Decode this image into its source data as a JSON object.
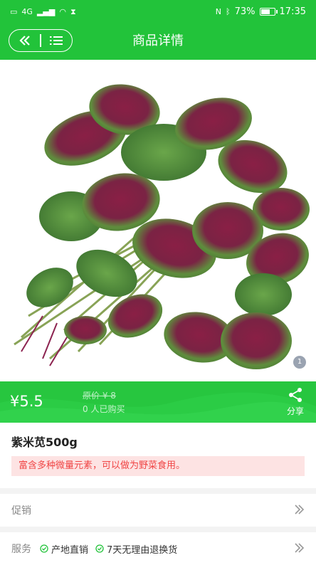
{
  "status_bar": {
    "signal_text": "4G",
    "battery": "73%",
    "battery_level": 0.73,
    "time": "17:35"
  },
  "header": {
    "title": "商品详情",
    "back_icon": "double-chevron-left-icon",
    "menu_icon": "list-icon"
  },
  "gallery": {
    "page_indicator": "1"
  },
  "price_bar": {
    "price": "¥5.5",
    "original_price": "原价 ¥ 8",
    "sold": "0 人已购买",
    "share_label": "分享"
  },
  "product": {
    "name": "紫米苋500g",
    "description": "富含多种微量元素，可以做为野菜食用。"
  },
  "rows": {
    "promo_label": "促销",
    "service_label": "服务",
    "services": [
      "产地直销",
      "7天无理由退换货"
    ]
  },
  "colors": {
    "brand_green": "#22c33a",
    "note_bg": "#fde3e3",
    "note_text": "#f04545"
  }
}
